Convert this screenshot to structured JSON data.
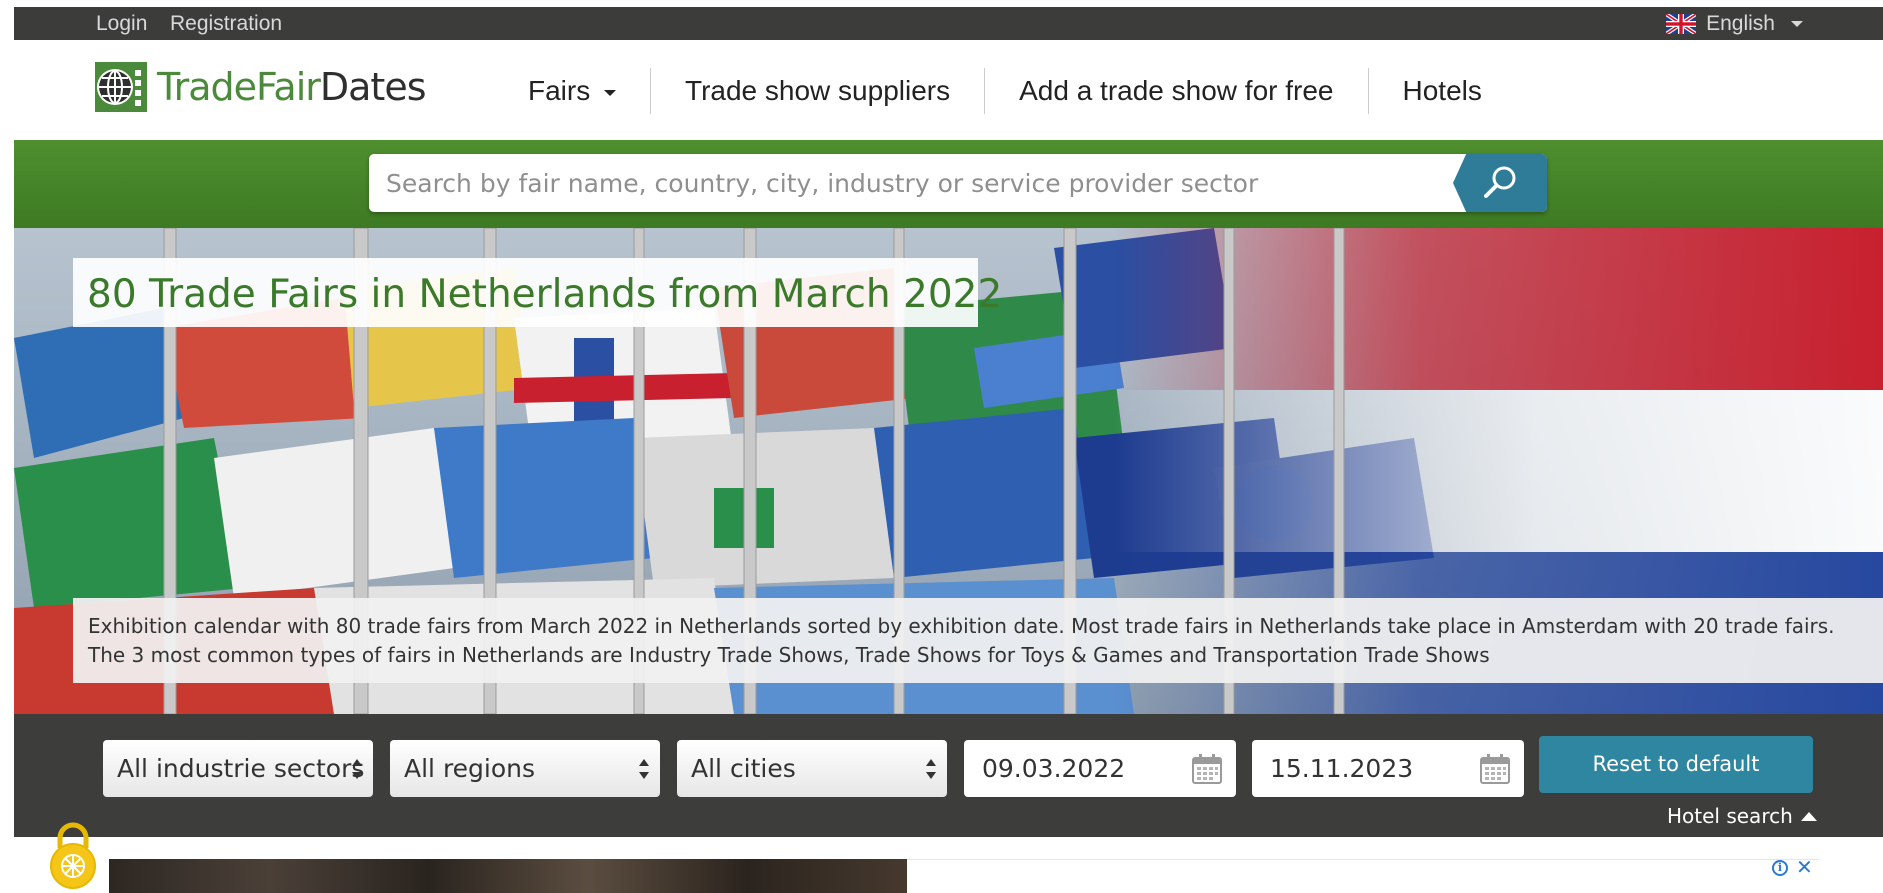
{
  "topbar": {
    "login": "Login",
    "registration": "Registration",
    "language": "English"
  },
  "logo": {
    "part1": "TradeFair",
    "part2": "Dates"
  },
  "nav": {
    "fairs": "Fairs",
    "suppliers": "Trade show suppliers",
    "add": "Add a trade show for free",
    "hotels": "Hotels"
  },
  "search": {
    "placeholder": "Search by fair name, country, city, industry or service provider sector"
  },
  "hero": {
    "title": "80 Trade Fairs in Netherlands from March 2022",
    "description": "Exhibition calendar with 80 trade fairs from March 2022 in Netherlands sorted by exhibition date. Most trade fairs in Netherlands take place in Amsterdam with 20 trade fairs. The 3 most common types of fairs in Netherlands are Industry Trade Shows, Trade Shows for Toys & Games and Transportation Trade Shows"
  },
  "filters": {
    "sector": "All industrie sectors",
    "region": "All regions",
    "city": "All cities",
    "date_from": "09.03.2022",
    "date_to": "15.11.2023",
    "reset": "Reset to default",
    "hotel_search": "Hotel search"
  },
  "colors": {
    "brand_green": "#4b8a3a",
    "accent_blue": "#2f86a0",
    "dark_bar": "#3c3d3b"
  }
}
